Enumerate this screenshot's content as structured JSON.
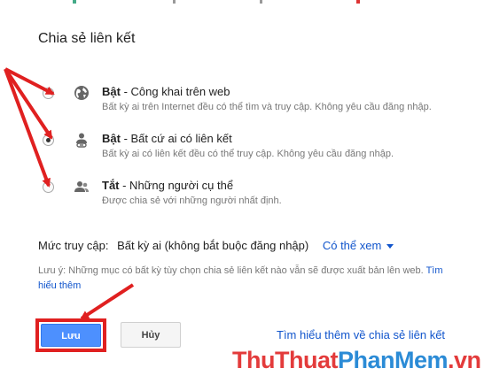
{
  "dialog": {
    "title": "Chia sẻ liên kết",
    "options": [
      {
        "title": "Bật",
        "subtitle": " - Công khai trên web",
        "desc": "Bất kỳ ai trên Internet đều có thể tìm và truy cập. Không yêu cầu đăng nhập.",
        "icon": "globe-icon",
        "checked": false
      },
      {
        "title": "Bật",
        "subtitle": " - Bất cứ ai có liên kết",
        "desc": "Bất kỳ ai có liên kết đều có thể truy cập. Không yêu cầu đăng nhập.",
        "icon": "person-link-icon",
        "checked": true
      },
      {
        "title": "Tắt",
        "subtitle": " - Những người cụ thể",
        "desc": "Được chia sẻ với những người nhất định.",
        "icon": "people-icon",
        "checked": false
      }
    ],
    "access": {
      "label": "Mức truy cập:",
      "level": "Bất kỳ ai (không bắt buộc đăng nhập)",
      "dropdown": "Có thể xem"
    },
    "note": {
      "text": "Lưu ý: Những mục có bất kỳ tùy chọn chia sẻ liên kết nào vẫn sẽ được xuất bản lên web. ",
      "link": "Tìm hiểu thêm"
    },
    "buttons": {
      "save": "Lưu",
      "cancel": "Hủy"
    },
    "learn_more": "Tìm hiểu thêm về chia sẻ liên kết"
  },
  "watermark": {
    "part1": "ThuThuat",
    "part2": "PhanMem",
    "part3": ".vn"
  },
  "colors": {
    "accent": "#4d90fe",
    "link": "#1155cc",
    "annotation": "#e02020"
  }
}
